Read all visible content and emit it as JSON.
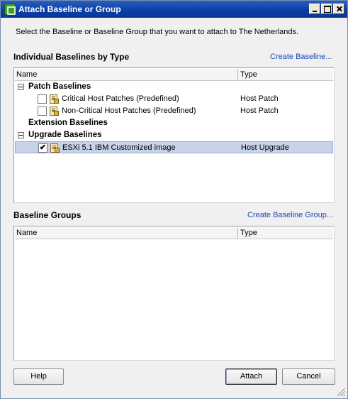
{
  "window": {
    "title": "Attach Baseline or Group",
    "instruction": "Select the Baseline or Baseline Group that you want to attach to The Netherlands."
  },
  "individual": {
    "title": "Individual Baselines by Type",
    "create_link": "Create Baseline...",
    "columns": {
      "name": "Name",
      "type": "Type"
    },
    "groups": [
      {
        "label": "Patch Baselines",
        "expanded": true,
        "items": [
          {
            "label": "Critical Host Patches (Predefined)",
            "type": "Host Patch",
            "checked": false,
            "selected": false,
            "check_mark": ""
          },
          {
            "label": "Non-Critical Host Patches (Predefined)",
            "type": "Host Patch",
            "checked": false,
            "selected": false,
            "check_mark": ""
          }
        ]
      },
      {
        "label": "Extension Baselines",
        "expanded": false,
        "items": []
      },
      {
        "label": "Upgrade Baselines",
        "expanded": true,
        "items": [
          {
            "label": "ESXi 5.1 IBM Customized image",
            "type": "Host Upgrade",
            "checked": true,
            "selected": true,
            "check_mark": "✔"
          }
        ]
      }
    ]
  },
  "groups_section": {
    "title": "Baseline Groups",
    "create_link": "Create Baseline Group...",
    "columns": {
      "name": "Name",
      "type": "Type"
    }
  },
  "buttons": {
    "help": "Help",
    "attach": "Attach",
    "cancel": "Cancel"
  },
  "colors": {
    "title_bar": "#0a3fa6",
    "link": "#1a47b8",
    "selected_row": "#c7d3e8"
  }
}
